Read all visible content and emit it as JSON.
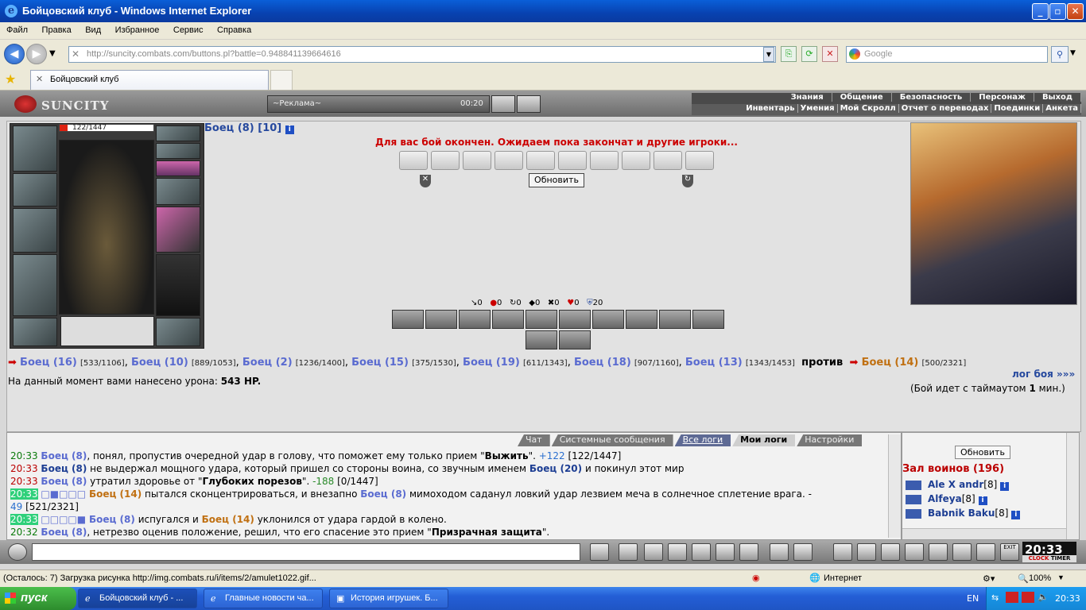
{
  "window": {
    "title": "Бойцовский клуб - Windows Internet Explorer"
  },
  "menu": [
    "Файл",
    "Правка",
    "Вид",
    "Избранное",
    "Сервис",
    "Справка"
  ],
  "address": {
    "url": "http://suncity.combats.com/buttons.pl?battle=0.948841139664616",
    "search_placeholder": "Google"
  },
  "tab": {
    "title": "Бойцовский клуб"
  },
  "game": {
    "logo": "SUNCITY",
    "ad_label": "~Реклама~",
    "ad_time": "00:20",
    "menu_top": [
      "Знания",
      "Общение",
      "Безопасность",
      "Персонаж",
      "Выход"
    ],
    "menu_sub": [
      "Инвентарь",
      "Умения",
      "Мой Скролл",
      "Отчет о переводах",
      "Поединки",
      "Анкета"
    ]
  },
  "player": {
    "hp": "122/1447",
    "name": "Боец (8) [10]"
  },
  "battle": {
    "message": "Для вас бой окончен. Ожидаем пока закончат и другие игроки...",
    "refresh": "Обновить",
    "stats": [
      "0",
      "0",
      "0",
      "0",
      "0",
      "0",
      "20"
    ],
    "allies": [
      {
        "name": "Боец (16)",
        "hp": "[533/1106]"
      },
      {
        "name": "Боец (10)",
        "hp": "[889/1053]"
      },
      {
        "name": "Боец (2)",
        "hp": "[1236/1400]"
      },
      {
        "name": "Боец (15)",
        "hp": "[375/1530]"
      },
      {
        "name": "Боец (19)",
        "hp": "[611/1343]"
      },
      {
        "name": "Боец (18)",
        "hp": "[907/1160]"
      },
      {
        "name": "Боец (13)",
        "hp": "[1343/1453]"
      }
    ],
    "vs": "против",
    "enemy": {
      "name": "Боец (14)",
      "hp": "[500/2321]"
    },
    "damage_label": "На данный момент вами нанесено урона:",
    "damage_value": "543 HP.",
    "log_link": "лог боя »»»",
    "timeout_pre": "(Бой идет с таймаутом",
    "timeout_num": "1",
    "timeout_post": "мин.)"
  },
  "chat": {
    "tabs": [
      "Чат",
      "Системные сообщения",
      "Все логи",
      "Мои логи",
      "Настройки"
    ],
    "lines": [
      {
        "time": "20:33",
        "a": "Боец (8)",
        "t1": ", понял, пропустив очередной удар в голову, что поможет ему только прием \"",
        "b": "Выжить",
        "t2": "\". ",
        "v": "+122",
        "t3": " [122/1447]"
      },
      {
        "time": "20:33",
        "a": "Боец (8)",
        "t1": " не выдержал мощного удара, который пришел со стороны воина, со звучным именем ",
        "b": "Боец (20)",
        "t2": " и покинул этот мир"
      },
      {
        "time": "20:33",
        "a": "Боец (8)",
        "t1": " утратил здоровье от \"",
        "b": "Глубоких порезов",
        "t2": "\". ",
        "v": "-188",
        "t3": " [0/1447]"
      },
      {
        "time": "20:33",
        "a": "Боец (14)",
        "t1": " пытался сконцентрироваться, и внезапно ",
        "b": "Боец (8)",
        "t2": " мимоходом саданул ловкий удар лезвием меча в солнечное сплетение врага. -"
      },
      {
        "cont": "49",
        "t3": " [521/2321]"
      },
      {
        "time": "20:33",
        "a": "Боец (8)",
        "t1": " испугался и ",
        "b": "Боец (14)",
        "t2": " уклонился от удара гардой в колено."
      },
      {
        "time": "20:32",
        "a": "Боец (8)",
        "t1": ", нетрезво оценив положение, решил, что его спасение это прием \"",
        "b": "Призрачная защита",
        "t2": "\"."
      }
    ]
  },
  "users": {
    "refresh": "Обновить",
    "hall": "Зал воинов (196)",
    "list": [
      {
        "name": "Ale X andr",
        "lvl": "[8]"
      },
      {
        "name": "Alfeya",
        "lvl": "[8]"
      },
      {
        "name": "Babnik Baku",
        "lvl": "[8]"
      }
    ]
  },
  "clock": {
    "time": "20:33",
    "clock_label": "CLOCK",
    "timer_label": "TIMER",
    "exit": "EXIT"
  },
  "status": {
    "text": "(Осталось: 7) Загрузка рисунка http://img.combats.ru/i/items/2/amulet1022.gif...",
    "zone": "Интернет",
    "zoom": "100%"
  },
  "taskbar": {
    "start": "пуск",
    "tasks": [
      "Бойцовский клуб - ...",
      "Главные новости ча...",
      "История игрушек. Б..."
    ],
    "lang": "EN",
    "time": "20:33"
  }
}
